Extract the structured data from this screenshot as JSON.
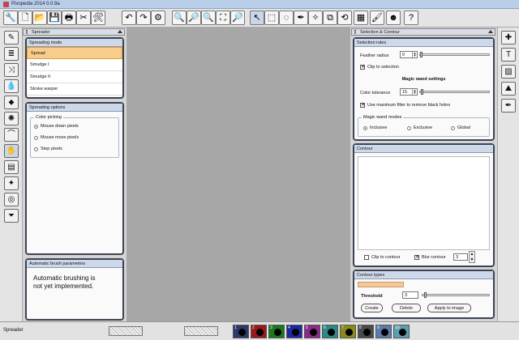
{
  "window": {
    "title": "Pixopedia 2014 0.0.9a"
  },
  "toolbar": {
    "icons": [
      {
        "name": "wrench-icon",
        "glyph": "🔧"
      },
      {
        "name": "new-file-icon",
        "glyph": "🗋"
      },
      {
        "name": "open-file-icon",
        "glyph": "📂"
      },
      {
        "name": "save-icon",
        "glyph": "💾"
      },
      {
        "name": "print-icon",
        "glyph": "🖶"
      },
      {
        "name": "scissors-icon",
        "glyph": "✂"
      },
      {
        "name": "tools-icon",
        "glyph": "🛠"
      },
      {
        "name": "undo-icon",
        "glyph": "↶"
      },
      {
        "name": "redo-icon",
        "glyph": "↷"
      },
      {
        "name": "settings-icon",
        "glyph": "⚙"
      },
      {
        "name": "zoom-in-icon",
        "glyph": "🔍"
      },
      {
        "name": "zoom-out-icon",
        "glyph": "🔎"
      },
      {
        "name": "zoom-icon",
        "glyph": "🔍"
      },
      {
        "name": "fit-screen-icon",
        "glyph": "⛶"
      },
      {
        "name": "zoom-actual-icon",
        "glyph": "🔎"
      },
      {
        "name": "select-arrow-icon",
        "glyph": "↖"
      },
      {
        "name": "crop-select-icon",
        "glyph": "⬚"
      },
      {
        "name": "lasso-icon",
        "glyph": "◌"
      },
      {
        "name": "eyedropper-icon",
        "glyph": "✒"
      },
      {
        "name": "magic-wand-icon",
        "glyph": "✧"
      },
      {
        "name": "resize-icon",
        "glyph": "⧉"
      },
      {
        "name": "rotate-icon",
        "glyph": "⟲"
      },
      {
        "name": "texture-icon",
        "glyph": "▦"
      },
      {
        "name": "brush-set-icon",
        "glyph": "🖌"
      },
      {
        "name": "mask-icon",
        "glyph": "☻"
      },
      {
        "name": "help-icon",
        "glyph": "?"
      }
    ]
  },
  "left_tools": [
    {
      "name": "brush-icon",
      "glyph": "✎"
    },
    {
      "name": "sliders-icon",
      "glyph": "≣"
    },
    {
      "name": "shuffle-icon",
      "glyph": "⤨"
    },
    {
      "name": "drops-icon",
      "glyph": "💧"
    },
    {
      "name": "drop-icon",
      "glyph": "⬥"
    },
    {
      "name": "gear-icon",
      "glyph": "✺"
    },
    {
      "name": "arc-icon",
      "glyph": "⌒"
    },
    {
      "name": "spreader-icon",
      "glyph": "✋"
    },
    {
      "name": "grid-icon",
      "glyph": "▤"
    },
    {
      "name": "sparkle-icon",
      "glyph": "✦"
    },
    {
      "name": "spiral-icon",
      "glyph": "◎"
    },
    {
      "name": "funnel-icon",
      "glyph": "⏷"
    }
  ],
  "right_tools": [
    {
      "name": "plus-icon",
      "glyph": "✚"
    },
    {
      "name": "text-icon",
      "glyph": "T"
    },
    {
      "name": "image-icon",
      "glyph": "▨"
    },
    {
      "name": "landscape-icon",
      "glyph": "⛰"
    },
    {
      "name": "pen-icon",
      "glyph": "✒"
    }
  ],
  "left_panel": {
    "header": "Spreader",
    "mode_group": {
      "title": "Spreading mode",
      "items": [
        "Spread",
        "Smudge I",
        "Smudge II",
        "Stroke warper"
      ]
    },
    "options_group": {
      "title": "Spreading options",
      "color_picking_label": "Color picking",
      "options": [
        "Mouse down pixels",
        "Mouse move pixels",
        "Step pixels"
      ]
    },
    "auto_group": {
      "title": "Automatic brush parameters",
      "message": "Automatic brushing is not yet implemented."
    }
  },
  "right_panel": {
    "header": "Selection & Contour",
    "selection_rules": {
      "title": "Selection rules",
      "feather_label": "Feather radius",
      "feather_value": "0",
      "feather_level": 0,
      "clip_label": "Clip to selection",
      "wand_heading": "Magic wand settings",
      "tolerance_label": "Color tolerance",
      "tolerance_value": "15",
      "max_filter_label": "Use maximum filter to remove black holes",
      "wand_modes_label": "Magic wand modes",
      "modes": [
        "Inclusive",
        "Exclusive",
        "Global"
      ]
    },
    "contour": {
      "title": "Contour",
      "clip_label": "Clip to contour",
      "blur_label": "Blur contour",
      "blur_value": "3"
    },
    "contour_types": {
      "title": "Contour types",
      "threshold_label": "Threshold",
      "threshold_value": "3",
      "buttons": [
        "Create",
        "Delete",
        "Apply to image"
      ]
    }
  },
  "statusbar": {
    "tool_name": "Spreader",
    "swatches": [
      {
        "num": "1",
        "color": "#2a3a6a"
      },
      {
        "num": "2",
        "color": "#9a1a1a"
      },
      {
        "num": "3",
        "color": "#1a7a1a"
      },
      {
        "num": "4",
        "color": "#1a2aa0"
      },
      {
        "num": "5",
        "color": "#8a2a8a"
      },
      {
        "num": "6",
        "color": "#2a8a8a"
      },
      {
        "num": "7",
        "color": "#8a8a1a"
      },
      {
        "num": "8",
        "color": "#4a4a4a"
      },
      {
        "num": "9",
        "color": "#5a7ab0"
      },
      {
        "num": "10",
        "color": "#5aa0b0"
      }
    ]
  }
}
